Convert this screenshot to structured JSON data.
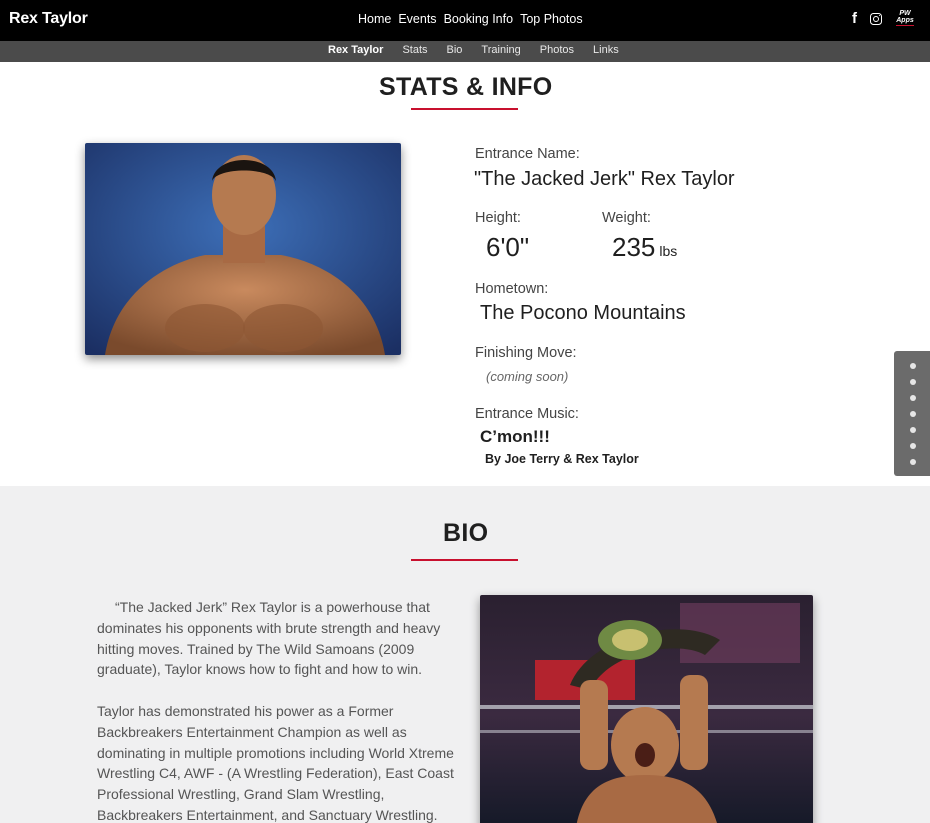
{
  "header": {
    "brand": "Rex Taylor",
    "nav": [
      "Home",
      "Events",
      "Booking Info",
      "Top Photos"
    ],
    "social": {
      "facebook_glyph": "f",
      "apps_line1": "PW",
      "apps_line2": "Apps"
    }
  },
  "subnav": {
    "items": [
      "Rex Taylor",
      "Stats",
      "Bio",
      "Training",
      "Photos",
      "Links"
    ],
    "active": "Rex Taylor"
  },
  "stats": {
    "title": "STATS & INFO",
    "entrance_name_label": "Entrance Name:",
    "entrance_name": "\"The Jacked Jerk\" Rex Taylor",
    "height_label": "Height:",
    "height": "6'0\"",
    "weight_label": "Weight:",
    "weight": "235",
    "weight_unit": "lbs",
    "hometown_label": "Hometown:",
    "hometown": "The Pocono Mountains",
    "finishing_label": "Finishing Move:",
    "finishing": "(coming soon)",
    "music_label": "Entrance Music:",
    "music_title": "C’mon!!!",
    "music_by": "By Joe Terry & Rex Taylor"
  },
  "bio": {
    "title": "BIO",
    "paragraph1": "“The Jacked Jerk” Rex Taylor is a powerhouse that dominates his opponents with brute strength and heavy hitting moves. Trained by The Wild Samoans (2009 graduate), Taylor knows how to fight and how to win.",
    "paragraph2": "Taylor has demonstrated his power as a Former Backbreakers Entertainment Champion as well as dominating in multiple promotions including World Xtreme Wrestling C4, AWF - (A Wrestling Federation), East Coast Professional Wrestling, Grand Slam Wrestling, Backbreakers Entertainment, and Sanctuary Wrestling."
  },
  "colors": {
    "accent": "#c8102e",
    "topbar": "#000000",
    "subbar": "#4b4b4b",
    "bio_bg": "#f0f0f1"
  },
  "dotnav": {
    "count": 7
  }
}
